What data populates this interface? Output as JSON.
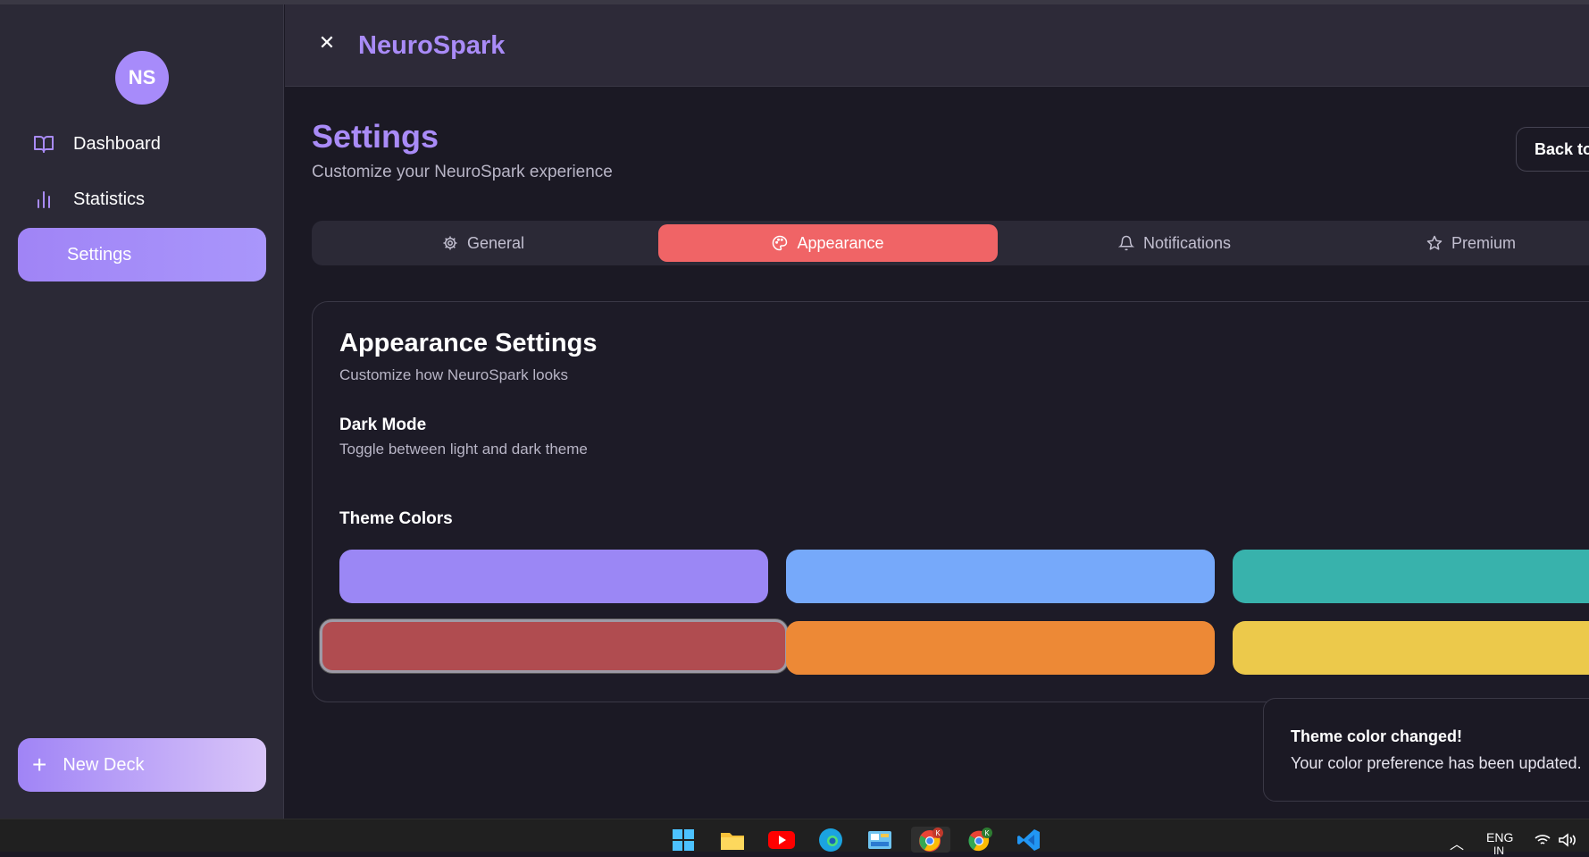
{
  "app": {
    "brand": "NeuroSpark",
    "avatar_initials": "NS"
  },
  "sidebar": {
    "items": [
      {
        "label": "Dashboard",
        "icon": "book-open-icon"
      },
      {
        "label": "Statistics",
        "icon": "bar-chart-icon"
      },
      {
        "label": "Settings",
        "icon": "none",
        "active": true
      }
    ],
    "new_deck_label": "New Deck"
  },
  "page": {
    "title": "Settings",
    "subtitle": "Customize your NeuroSpark experience",
    "back_label": "Back to"
  },
  "tabs": [
    {
      "label": "General",
      "icon": "gear-icon"
    },
    {
      "label": "Appearance",
      "icon": "palette-icon",
      "active": true
    },
    {
      "label": "Notifications",
      "icon": "bell-icon"
    },
    {
      "label": "Premium",
      "icon": "star-icon"
    }
  ],
  "appearance": {
    "title": "Appearance Settings",
    "subtitle": "Customize how NeuroSpark looks",
    "dark_mode_label": "Dark Mode",
    "dark_mode_desc": "Toggle between light and dark theme",
    "theme_colors_label": "Theme Colors",
    "swatches": [
      {
        "color": "#9b87f5"
      },
      {
        "color": "#76a9fa"
      },
      {
        "color": "#38b2ac"
      },
      {
        "color": "#b04c50",
        "selected": true
      },
      {
        "color": "#ed8936"
      },
      {
        "color": "#ecc94b"
      }
    ]
  },
  "toast": {
    "title": "Theme color changed!",
    "description": "Your color preference has been updated."
  },
  "taskbar": {
    "language": "ENG",
    "region": "IN"
  }
}
